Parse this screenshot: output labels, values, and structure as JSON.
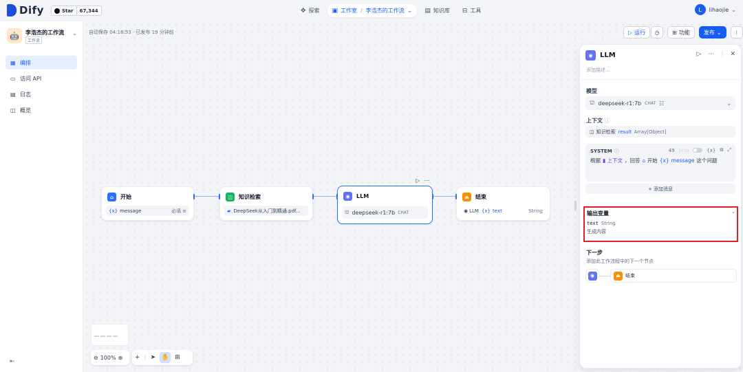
{
  "topbar": {
    "logo": "Dify",
    "github": {
      "star_label": "Star",
      "count": "67,344"
    },
    "nav": {
      "explore": "探索",
      "studio": "工作室",
      "current_app": "李浩杰的工作流",
      "knowledge": "知识库",
      "tools": "工具"
    },
    "user": {
      "initial": "L",
      "name": "lihaojie"
    }
  },
  "sidebar": {
    "app_name": "李浩杰的工作流",
    "app_tag": "工作流",
    "items": [
      {
        "label": "编排",
        "icon": "layout-icon",
        "active": true
      },
      {
        "label": "访问 API",
        "icon": "terminal-icon"
      },
      {
        "label": "日志",
        "icon": "log-icon"
      },
      {
        "label": "概览",
        "icon": "chart-icon"
      }
    ]
  },
  "canvas": {
    "autosave": "自动保存 04:18:53 · 已发布 19 分钟前",
    "actions": {
      "run": "运行",
      "features": "功能",
      "publish": "发布"
    },
    "nodes": {
      "start": {
        "title": "开始",
        "var_prefix": "{x}",
        "var": "message",
        "required": "必填"
      },
      "knowledge": {
        "title": "知识检索",
        "doc": "DeepSeek从入门到精通.pdf..."
      },
      "llm": {
        "title": "LLM",
        "model": "deepseek-r1:7b",
        "mode": "CHAT"
      },
      "end": {
        "title": "结束",
        "source": "LLM",
        "var_prefix": "{x}",
        "var": "text",
        "type": "String"
      }
    },
    "zoom": "100%"
  },
  "panel": {
    "title": "LLM",
    "desc_placeholder": "添加描述...",
    "model_label": "模型",
    "model": "deepseek-r1:7b",
    "model_mode": "CHAT",
    "context_label": "上下文",
    "context_source": "知识检索",
    "context_var": "result",
    "context_type": "Array[Object]",
    "system": {
      "label": "SYSTEM",
      "count": "49",
      "jinja": "Jinja",
      "vars_button": "{x}",
      "p1": "根据",
      "ctx": "上下文",
      "p2": "，回答",
      "start_ref": "开始",
      "msg_prefix": "{x}",
      "msg_var": "message",
      "p3": "这个问题"
    },
    "add_message": "+ 添加消息",
    "output": {
      "title": "输出变量",
      "var": "text",
      "type": "String",
      "desc": "生成内容"
    },
    "next": {
      "title": "下一步",
      "desc": "添加此工作流程中的下一个节点",
      "target": "结束"
    }
  }
}
